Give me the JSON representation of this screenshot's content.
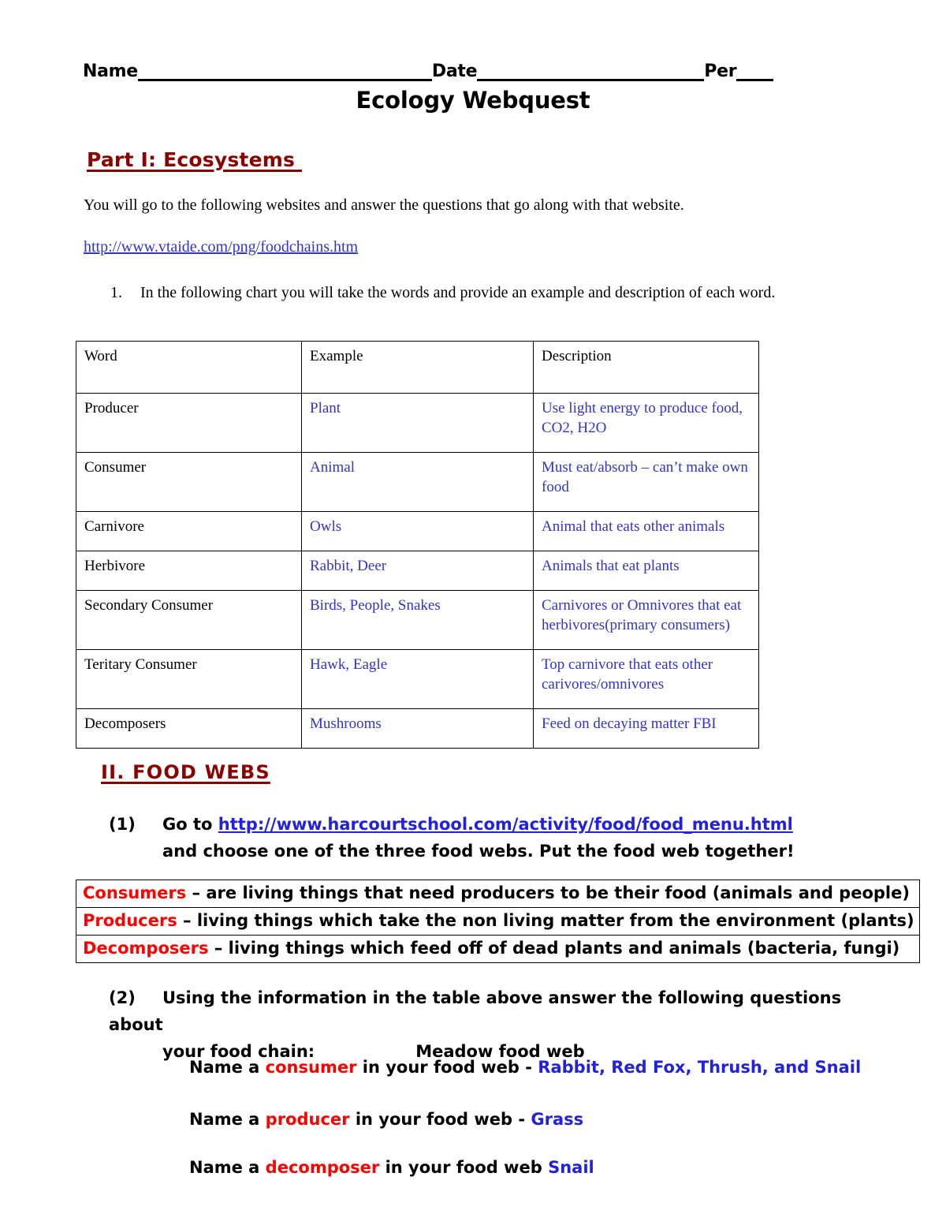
{
  "header": {
    "name_label": "Name",
    "date_label": "Date",
    "per_label": "Per",
    "title": "Ecology Webquest"
  },
  "part1": {
    "heading": "Part I: Ecosystems ",
    "intro": "You will go to the following websites and answer the questions that go along with that website.",
    "link": "http://www.vtaide.com/png/foodchains.htm",
    "q1_number": "1.",
    "q1_text": "In the following chart you will take the words and provide an example and description of each word."
  },
  "word_table": {
    "columns": [
      "Word",
      "Example",
      "Description"
    ],
    "rows": [
      {
        "word": "Producer",
        "example": "Plant",
        "description": "Use light energy to produce food, CO2, H2O"
      },
      {
        "word": "Consumer",
        "example": "Animal",
        "description": "Must eat/absorb – can’t make own food"
      },
      {
        "word": "Carnivore",
        "example": "Owls",
        "description": "Animal that eats other animals"
      },
      {
        "word": "Herbivore",
        "example": "Rabbit, Deer",
        "description": "Animals that eat plants"
      },
      {
        "word": "Secondary Consumer",
        "example": "Birds, People, Snakes",
        "description": "Carnivores or Omnivores that eat herbivores(primary consumers)"
      },
      {
        "word": "Teritary Consumer",
        "example": "Hawk, Eagle",
        "description": "Top carnivore that eats other carivores/omnivores"
      },
      {
        "word": "Decomposers",
        "example": "Mushrooms",
        "description": "Feed on decaying matter FBI"
      }
    ]
  },
  "part2": {
    "heading": "II. FOOD WEBS",
    "q1_number": "(1)",
    "q1_prefix": "Go to ",
    "q1_link": "http://www.harcourtschool.com/activity/food/food_menu.html",
    "q1_line2": "and choose one of the three food webs. Put the food web together!",
    "definitions": [
      {
        "term": "Consumers",
        "text": " – are living things that need producers to be their food (animals and people)"
      },
      {
        "term": "Producers",
        "text": " – living things which take the non living matter from the environment (plants)"
      },
      {
        "term": "Decomposers",
        "text": " – living things which feed off of dead plants and animals (bacteria, fungi)"
      }
    ],
    "q2_number": "(2)",
    "q2_line1": "Using the information in the table above answer the following questions about",
    "q2_line2": "your food chain:",
    "q2_foodweb": "Meadow food web",
    "answers": [
      {
        "prefix": "Name a ",
        "term": "consumer",
        "middle": " in your food web - ",
        "value": "Rabbit, Red Fox, Thrush, and Snail"
      },
      {
        "prefix": "Name a ",
        "term": "producer",
        "middle": " in your food web - ",
        "value": "Grass"
      },
      {
        "prefix": "Name a ",
        "term": "decomposer",
        "middle": " in your food web ",
        "value": "Snail"
      }
    ]
  },
  "colors": {
    "heading_maroon": "#8B0000",
    "answer_blue": "#2222DD",
    "term_red": "#FF0000",
    "link_blue": "#3333CC"
  }
}
